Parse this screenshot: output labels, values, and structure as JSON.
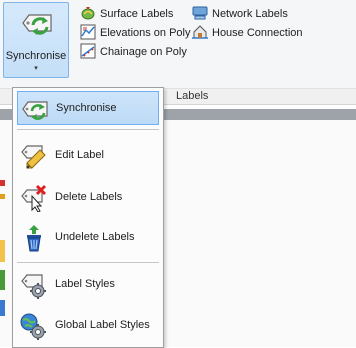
{
  "ribbon": {
    "synchronise": {
      "label": "Synchronise",
      "arrow": "▾",
      "icon": "synchronise-icon"
    },
    "buttons": [
      {
        "label": "Surface  Labels",
        "icon": "surface-labels-icon"
      },
      {
        "label": "Network Labels",
        "icon": "network-labels-icon"
      },
      {
        "label": "Elevations on Poly",
        "icon": "elevations-on-poly-icon"
      },
      {
        "label": "House Connection",
        "icon": "house-connection-icon"
      },
      {
        "label": "Chainage on Poly",
        "icon": "chainage-on-poly-icon"
      }
    ],
    "group_label": "Labels"
  },
  "menu": {
    "items": [
      {
        "label": "Synchronise",
        "icon": "synchronise-icon",
        "selected": true
      },
      {
        "label": "Edit Label",
        "icon": "edit-label-icon"
      },
      {
        "label": "Delete Labels",
        "icon": "delete-labels-icon"
      },
      {
        "label": "Undelete Labels",
        "icon": "undelete-labels-icon"
      },
      {
        "label": "Label Styles",
        "icon": "label-styles-icon"
      },
      {
        "label": "Global Label Styles",
        "icon": "global-label-styles-icon"
      }
    ]
  },
  "colors": {
    "ribbon_bg": "#f5f6f7",
    "hover_fill": "#c4dff8",
    "hover_border": "#7eb4ea",
    "tag_green": "#3aa142",
    "delete_red": "#e02020",
    "bin_blue": "#1f4e9c"
  }
}
